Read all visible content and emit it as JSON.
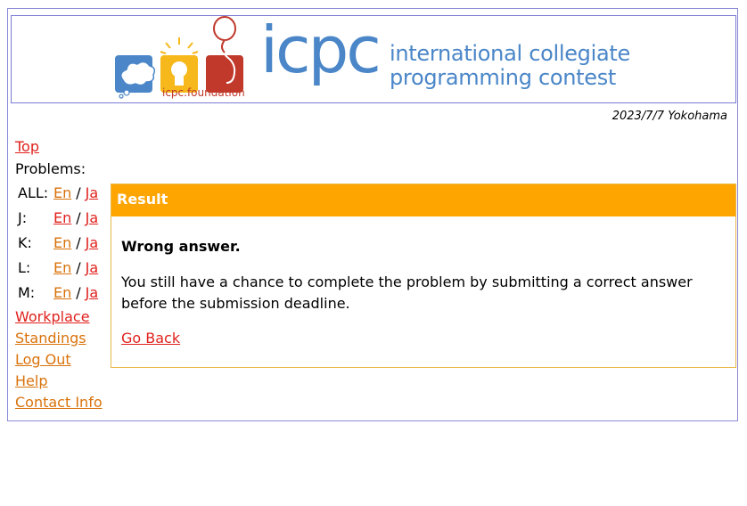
{
  "banner": {
    "logo_word": "icpc",
    "tagline_line1": "international collegiate",
    "tagline_line2": "programming contest",
    "foundation": "icpc.foundation",
    "colors": {
      "blue": "#4a86c8",
      "yellow": "#f6b81a",
      "red": "#c0392b"
    }
  },
  "header": {
    "date_location": "2023/7/7 Yokohama"
  },
  "nav": {
    "top": "Top",
    "problems_label": "Problems:",
    "problems": [
      {
        "label": "ALL:",
        "en": "En",
        "ja": "Ja",
        "en_visited": true,
        "ja_visited": false
      },
      {
        "label": "J:",
        "en": "En",
        "ja": "Ja",
        "en_visited": false,
        "ja_visited": false
      },
      {
        "label": "K:",
        "en": "En",
        "ja": "Ja",
        "en_visited": true,
        "ja_visited": false
      },
      {
        "label": "L:",
        "en": "En",
        "ja": "Ja",
        "en_visited": true,
        "ja_visited": false
      },
      {
        "label": "M:",
        "en": "En",
        "ja": "Ja",
        "en_visited": true,
        "ja_visited": false
      }
    ],
    "separator": "/",
    "links": {
      "workplace": "Workplace",
      "standings": "Standings",
      "logout": "Log Out",
      "help": "Help",
      "contact": "Contact Info"
    }
  },
  "result": {
    "heading": "Result",
    "title": "Wrong answer.",
    "message": "You still have a chance to complete the problem by submitting a correct answer before the submission deadline.",
    "go_back": "Go Back",
    "accent": "#ffa500"
  }
}
